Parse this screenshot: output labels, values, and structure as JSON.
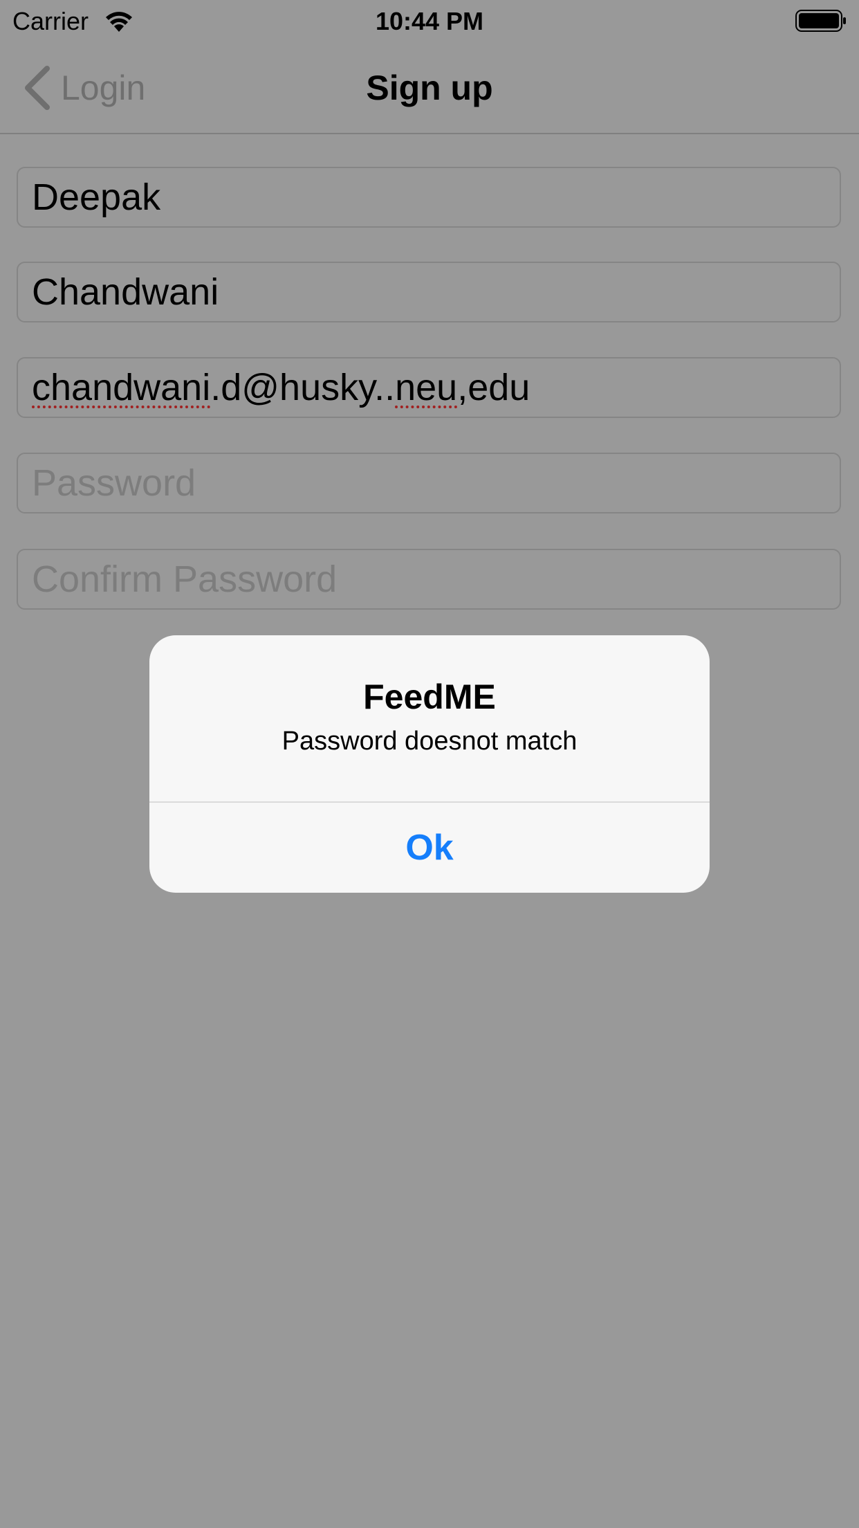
{
  "status_bar": {
    "carrier": "Carrier",
    "time": "10:44 PM",
    "wifi_icon": "wifi-icon",
    "battery_icon": "battery-icon"
  },
  "nav": {
    "back_label": "Login",
    "back_icon": "chevron-left-icon",
    "title": "Sign up"
  },
  "form": {
    "first_name": "Deepak",
    "last_name": "Chandwani",
    "email_part1": "chandwani",
    "email_part2": ".d@husky..",
    "email_part3": "neu",
    "email_part4": ",edu",
    "password_placeholder": "Password",
    "confirm_password_placeholder": "Confirm Password"
  },
  "alert": {
    "title": "FeedME",
    "message": "Password doesnot match",
    "ok_label": "Ok"
  },
  "colors": {
    "dim_background": "#999999",
    "alert_background": "#f7f7f7",
    "accent": "#157efb",
    "spellcheck": "#a12020"
  }
}
